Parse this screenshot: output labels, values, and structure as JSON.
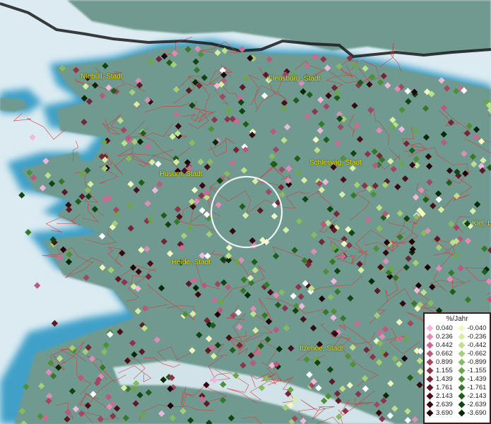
{
  "map": {
    "cities": [
      {
        "name": "Niebüll, Stadt"
      },
      {
        "name": "Flensburg, Stadt"
      },
      {
        "name": "Husum, Stadt"
      },
      {
        "name": "Schleswig, Stadt"
      },
      {
        "name": "Heide, Stadt"
      },
      {
        "name": "Kiel, L"
      },
      {
        "name": "Itzehoe, Stadt"
      }
    ],
    "colors": {
      "water": "#dcebf2",
      "shallow_water": "#3fa0c8",
      "land": "#6f9a90",
      "district_borders": "#d43a3a",
      "state_border": "#1a1a1a",
      "label": "#f0e000",
      "selection_ring": "#ffffff"
    }
  },
  "legend": {
    "title": "%/Jahr",
    "positive": [
      {
        "label": "0.040",
        "color": "#f2b6dc"
      },
      {
        "label": "0.236",
        "color": "#e08cb8"
      },
      {
        "label": "0.442",
        "color": "#c96b94"
      },
      {
        "label": "0.662",
        "color": "#b75a7c"
      },
      {
        "label": "0.899",
        "color": "#a24763"
      },
      {
        "label": "1.155",
        "color": "#8c344b"
      },
      {
        "label": "1.439",
        "color": "#752536"
      },
      {
        "label": "1.761",
        "color": "#5f1926"
      },
      {
        "label": "2.143",
        "color": "#4a0f19"
      },
      {
        "label": "2.639",
        "color": "#360810"
      },
      {
        "label": "3.690",
        "color": "#200308"
      }
    ],
    "negative": [
      {
        "label": "-0.040",
        "color": "#f0f8c0"
      },
      {
        "label": "-0.236",
        "color": "#d6eea4"
      },
      {
        "label": "-0.442",
        "color": "#bfe08a"
      },
      {
        "label": "-0.662",
        "color": "#a5cf74"
      },
      {
        "label": "-0.899",
        "color": "#88bb5e"
      },
      {
        "label": "-1.155",
        "color": "#6ba64a"
      },
      {
        "label": "-1.439",
        "color": "#4f8f38"
      },
      {
        "label": "-1.761",
        "color": "#367828"
      },
      {
        "label": "-2.143",
        "color": "#1f5e1a"
      },
      {
        "label": "-2.639",
        "color": "#0f4510"
      },
      {
        "label": "-3.690",
        "color": "#052a08"
      }
    ]
  }
}
